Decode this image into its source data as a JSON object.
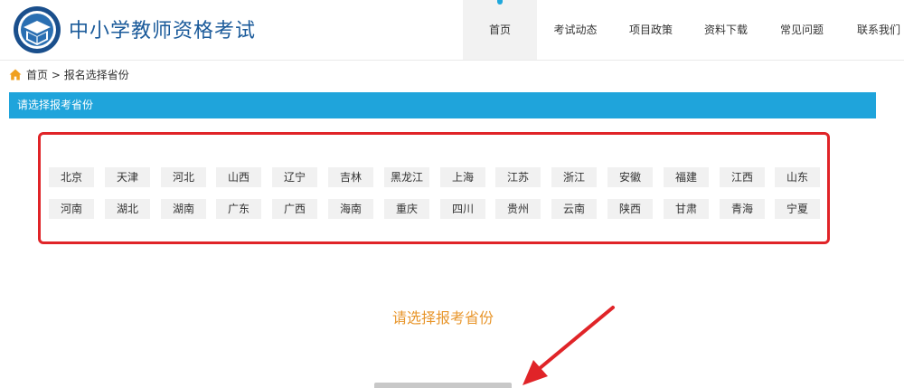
{
  "header": {
    "site_title": "中小学教师资格考试",
    "nav": [
      {
        "label": "首页",
        "active": true
      },
      {
        "label": "考试动态",
        "active": false
      },
      {
        "label": "项目政策",
        "active": false
      },
      {
        "label": "资料下载",
        "active": false
      },
      {
        "label": "常见问题",
        "active": false
      },
      {
        "label": "联系我们",
        "active": false
      }
    ]
  },
  "breadcrumb": {
    "home": "首页",
    "separator": ">",
    "current": "报名选择省份"
  },
  "section": {
    "title": "请选择报考省份"
  },
  "provinces": [
    "北京",
    "天津",
    "河北",
    "山西",
    "辽宁",
    "吉林",
    "黑龙江",
    "上海",
    "江苏",
    "浙江",
    "安徽",
    "福建",
    "江西",
    "山东",
    "河南",
    "湖北",
    "湖南",
    "广东",
    "广西",
    "海南",
    "重庆",
    "四川",
    "贵州",
    "云南",
    "陕西",
    "甘肃",
    "青海",
    "宁夏"
  ],
  "prompt": {
    "text": "请选择报考省份"
  },
  "colors": {
    "accent": "#1fa4db",
    "title_blue": "#1a5a9a",
    "annotation_red": "#e02428",
    "prompt_orange": "#e8962c",
    "button_bg": "#f1f1f1",
    "home_icon": "#f0a020"
  },
  "icons": {
    "logo": "book-emblem-icon",
    "home": "home-icon",
    "annotation": "arrow-icon"
  }
}
